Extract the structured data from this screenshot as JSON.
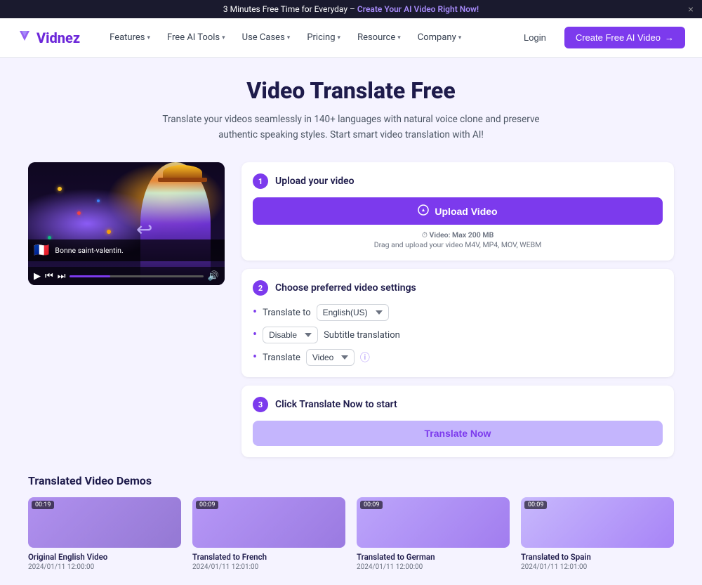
{
  "banner": {
    "text": "3 Minutes Free Time for Everyday – ",
    "link_text": "Create Your AI Video Right Now!",
    "close_label": "×"
  },
  "nav": {
    "logo_text": "Vidnez",
    "items": [
      {
        "label": "Features",
        "has_dropdown": true
      },
      {
        "label": "Free AI Tools",
        "has_dropdown": true
      },
      {
        "label": "Use Cases",
        "has_dropdown": true
      },
      {
        "label": "Pricing",
        "has_dropdown": true
      },
      {
        "label": "Resource",
        "has_dropdown": true
      },
      {
        "label": "Company",
        "has_dropdown": true
      }
    ],
    "login_label": "Login",
    "create_label": "Create Free AI Video",
    "create_arrow": "→"
  },
  "hero": {
    "title": "Video Translate Free",
    "subtitle": "Translate your videos seamlessly in 140+ languages with natural voice clone and preserve authentic speaking styles. Start smart video translation with AI!"
  },
  "video": {
    "subtitle_flag": "🇫🇷",
    "subtitle_text": "Bonne saint-valentin.",
    "controls": {
      "play": "▶",
      "rewind": "⟪",
      "forward": "⟫",
      "volume": "🔊"
    }
  },
  "steps": [
    {
      "num": "1",
      "title": "Upload your video",
      "upload_btn": "Upload Video",
      "hint_max": "Video: Max 200 MB",
      "hint_drag": "Drag and upload your video M4V, MP4, MOV, WEBM"
    },
    {
      "num": "2",
      "title": "Choose preferred video settings",
      "settings": [
        {
          "label": "Translate to",
          "value": "English(US)",
          "type": "select"
        },
        {
          "label": "Disable",
          "secondary_label": "Subtitle translation",
          "type": "toggle"
        },
        {
          "label": "Translate",
          "value": "Video",
          "type": "select",
          "has_info": true
        }
      ]
    },
    {
      "num": "3",
      "title": "Click Translate Now to start",
      "translate_btn": "Translate Now"
    }
  ],
  "demos": {
    "title": "Translated Video Demos",
    "cards": [
      {
        "duration": "00:19",
        "name": "Original English Video",
        "date": "2024/01/11 12:00:00"
      },
      {
        "duration": "00:09",
        "name": "Translated to French",
        "date": "2024/01/11 12:01:00"
      },
      {
        "duration": "00:09",
        "name": "Translated to German",
        "date": "2024/01/11 12:00:00"
      },
      {
        "duration": "00:09",
        "name": "Translated to Spain",
        "date": "2024/01/11 12:01:00"
      }
    ]
  }
}
